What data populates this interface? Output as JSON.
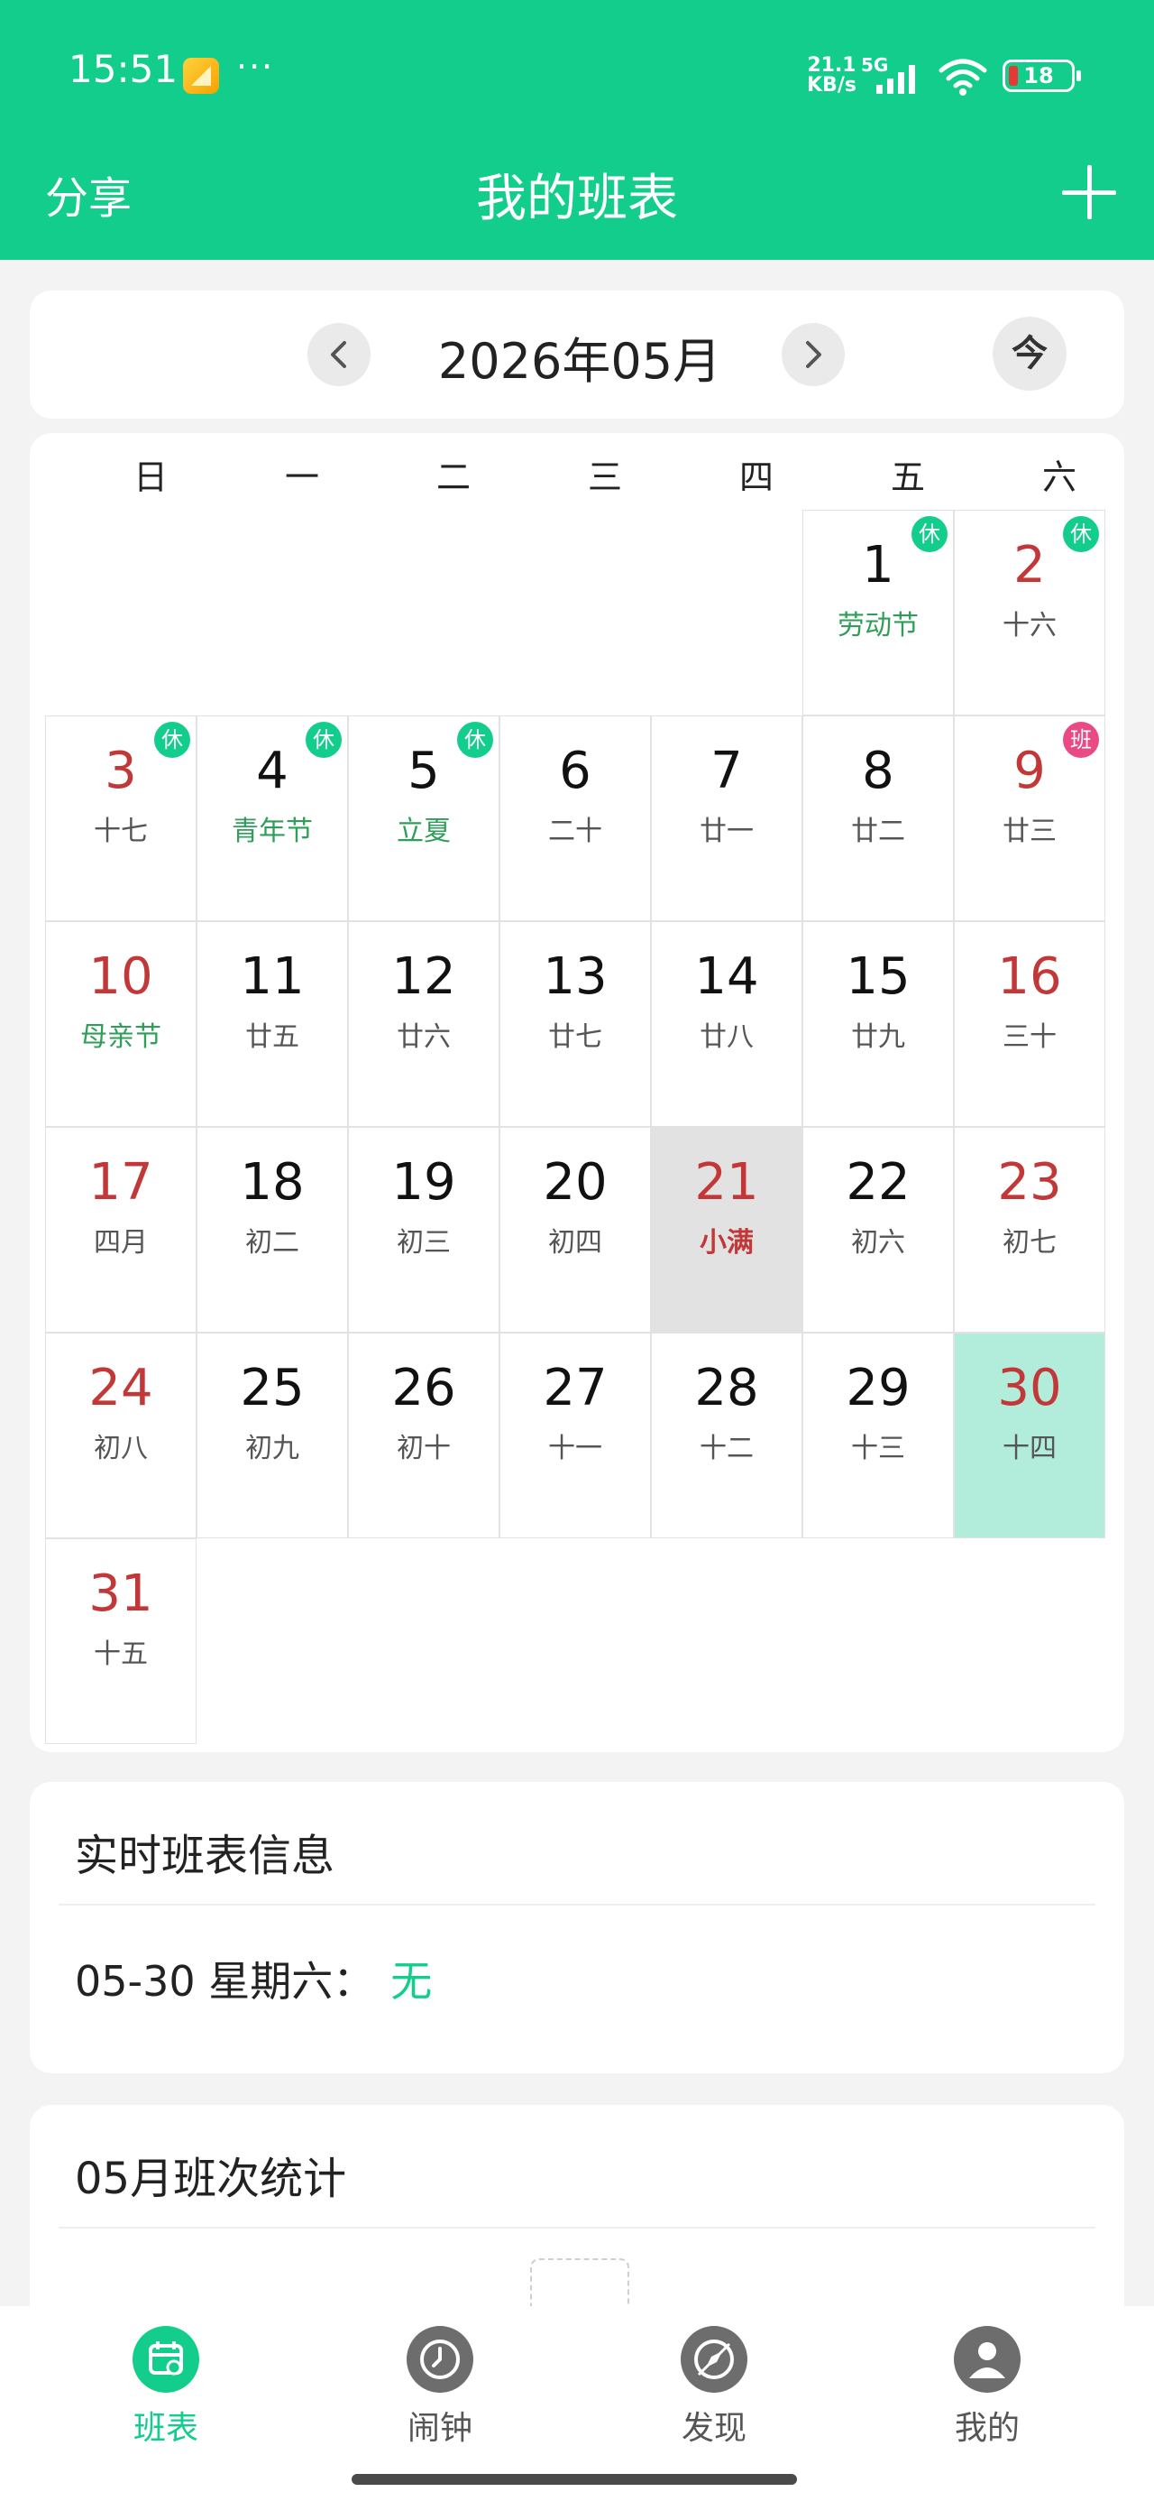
{
  "status_bar": {
    "time": "15:51",
    "dots": "···",
    "net_speed_top": "21.1",
    "net_speed_bottom": "KB/s",
    "network": "5G",
    "battery": "18"
  },
  "header": {
    "left_action": "分享",
    "title": "我的班表",
    "right_action_icon": "plus-icon"
  },
  "month_nav": {
    "label": "2026年05月",
    "prev_icon": "chevron-left-icon",
    "next_icon": "chevron-right-icon",
    "today_label": "今"
  },
  "calendar": {
    "weekdays": [
      "日",
      "一",
      "二",
      "三",
      "四",
      "五",
      "六"
    ],
    "days": [
      {
        "day": "1",
        "lunar": "劳动节",
        "red": false,
        "lunar_style": "green",
        "badge": "休",
        "badge_type": "rest"
      },
      {
        "day": "2",
        "lunar": "十六",
        "red": true,
        "lunar_style": "",
        "badge": "休",
        "badge_type": "rest"
      },
      {
        "day": "3",
        "lunar": "十七",
        "red": true,
        "lunar_style": "",
        "badge": "休",
        "badge_type": "rest"
      },
      {
        "day": "4",
        "lunar": "青年节",
        "red": false,
        "lunar_style": "green",
        "badge": "休",
        "badge_type": "rest"
      },
      {
        "day": "5",
        "lunar": "立夏",
        "red": false,
        "lunar_style": "green",
        "badge": "休",
        "badge_type": "rest"
      },
      {
        "day": "6",
        "lunar": "二十",
        "red": false,
        "lunar_style": "",
        "badge": "",
        "badge_type": ""
      },
      {
        "day": "7",
        "lunar": "廿一",
        "red": false,
        "lunar_style": "",
        "badge": "",
        "badge_type": ""
      },
      {
        "day": "8",
        "lunar": "廿二",
        "red": false,
        "lunar_style": "",
        "badge": "",
        "badge_type": ""
      },
      {
        "day": "9",
        "lunar": "廿三",
        "red": true,
        "lunar_style": "",
        "badge": "班",
        "badge_type": "work"
      },
      {
        "day": "10",
        "lunar": "母亲节",
        "red": true,
        "lunar_style": "green",
        "badge": "",
        "badge_type": ""
      },
      {
        "day": "11",
        "lunar": "廿五",
        "red": false,
        "lunar_style": "",
        "badge": "",
        "badge_type": ""
      },
      {
        "day": "12",
        "lunar": "廿六",
        "red": false,
        "lunar_style": "",
        "badge": "",
        "badge_type": ""
      },
      {
        "day": "13",
        "lunar": "廿七",
        "red": false,
        "lunar_style": "",
        "badge": "",
        "badge_type": ""
      },
      {
        "day": "14",
        "lunar": "廿八",
        "red": false,
        "lunar_style": "",
        "badge": "",
        "badge_type": ""
      },
      {
        "day": "15",
        "lunar": "廿九",
        "red": false,
        "lunar_style": "",
        "badge": "",
        "badge_type": ""
      },
      {
        "day": "16",
        "lunar": "三十",
        "red": true,
        "lunar_style": "",
        "badge": "",
        "badge_type": ""
      },
      {
        "day": "17",
        "lunar": "四月",
        "red": true,
        "lunar_style": "",
        "badge": "",
        "badge_type": ""
      },
      {
        "day": "18",
        "lunar": "初二",
        "red": false,
        "lunar_style": "",
        "badge": "",
        "badge_type": ""
      },
      {
        "day": "19",
        "lunar": "初三",
        "red": false,
        "lunar_style": "",
        "badge": "",
        "badge_type": ""
      },
      {
        "day": "20",
        "lunar": "初四",
        "red": false,
        "lunar_style": "",
        "badge": "",
        "badge_type": ""
      },
      {
        "day": "21",
        "lunar": "小满",
        "red": true,
        "lunar_style": "red",
        "badge": "",
        "badge_type": "",
        "state": "today"
      },
      {
        "day": "22",
        "lunar": "初六",
        "red": false,
        "lunar_style": "",
        "badge": "",
        "badge_type": ""
      },
      {
        "day": "23",
        "lunar": "初七",
        "red": true,
        "lunar_style": "",
        "badge": "",
        "badge_type": ""
      },
      {
        "day": "24",
        "lunar": "初八",
        "red": true,
        "lunar_style": "",
        "badge": "",
        "badge_type": ""
      },
      {
        "day": "25",
        "lunar": "初九",
        "red": false,
        "lunar_style": "",
        "badge": "",
        "badge_type": ""
      },
      {
        "day": "26",
        "lunar": "初十",
        "red": false,
        "lunar_style": "",
        "badge": "",
        "badge_type": ""
      },
      {
        "day": "27",
        "lunar": "十一",
        "red": false,
        "lunar_style": "",
        "badge": "",
        "badge_type": ""
      },
      {
        "day": "28",
        "lunar": "十二",
        "red": false,
        "lunar_style": "",
        "badge": "",
        "badge_type": ""
      },
      {
        "day": "29",
        "lunar": "十三",
        "red": false,
        "lunar_style": "",
        "badge": "",
        "badge_type": ""
      },
      {
        "day": "30",
        "lunar": "十四",
        "red": true,
        "lunar_style": "",
        "badge": "",
        "badge_type": "",
        "state": "selected"
      },
      {
        "day": "31",
        "lunar": "十五",
        "red": true,
        "lunar_style": "",
        "badge": "",
        "badge_type": ""
      }
    ]
  },
  "realtime_info": {
    "title": "实时班表信息",
    "date_label": "05-30 星期六：",
    "value": "无"
  },
  "monthly_stats": {
    "title": "05月班次统计"
  },
  "bottom_nav": {
    "items": [
      {
        "label": "班表",
        "icon": "calendar-icon",
        "active": true
      },
      {
        "label": "闹钟",
        "icon": "clock-icon",
        "active": false
      },
      {
        "label": "发现",
        "icon": "compass-icon",
        "active": false
      },
      {
        "label": "我的",
        "icon": "user-icon",
        "active": false
      }
    ]
  },
  "colors": {
    "brand": "#12cd8c",
    "holiday_red": "#c23838",
    "festival_green": "#2e9e58",
    "work_badge": "#e94a86",
    "selected_bg": "#b2eddb",
    "today_bg": "#e2e2e2"
  }
}
